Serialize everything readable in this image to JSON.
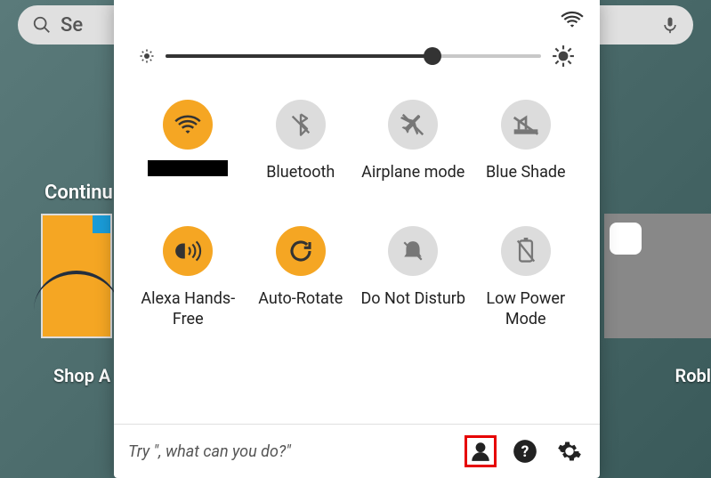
{
  "background": {
    "search_placeholder": "Se",
    "continue_label": "Continu",
    "left_app_label": "Shop A",
    "right_app_label": "Robl"
  },
  "panel": {
    "brightness": {
      "percent": 71
    },
    "toggles": [
      {
        "id": "wifi",
        "label": "",
        "ssid_hidden": true,
        "state": "on"
      },
      {
        "id": "bluetooth",
        "label": "Bluetooth",
        "state": "off"
      },
      {
        "id": "airplane",
        "label": "Airplane mode",
        "state": "off"
      },
      {
        "id": "blueshade",
        "label": "Blue Shade",
        "state": "off"
      },
      {
        "id": "alexa",
        "label": "Alexa Hands-Free",
        "state": "on"
      },
      {
        "id": "autorotate",
        "label": "Auto-Rotate",
        "state": "on"
      },
      {
        "id": "dnd",
        "label": "Do Not Disturb",
        "state": "off"
      },
      {
        "id": "lowpower",
        "label": "Low Power Mode",
        "state": "off"
      }
    ],
    "footer": {
      "alexa_hint": "Try \", what can you do?\"",
      "icons": [
        "user",
        "help",
        "settings"
      ]
    }
  },
  "colors": {
    "accent": "#f5a623",
    "inactive": "#dcdcdc",
    "track": "#333333"
  }
}
